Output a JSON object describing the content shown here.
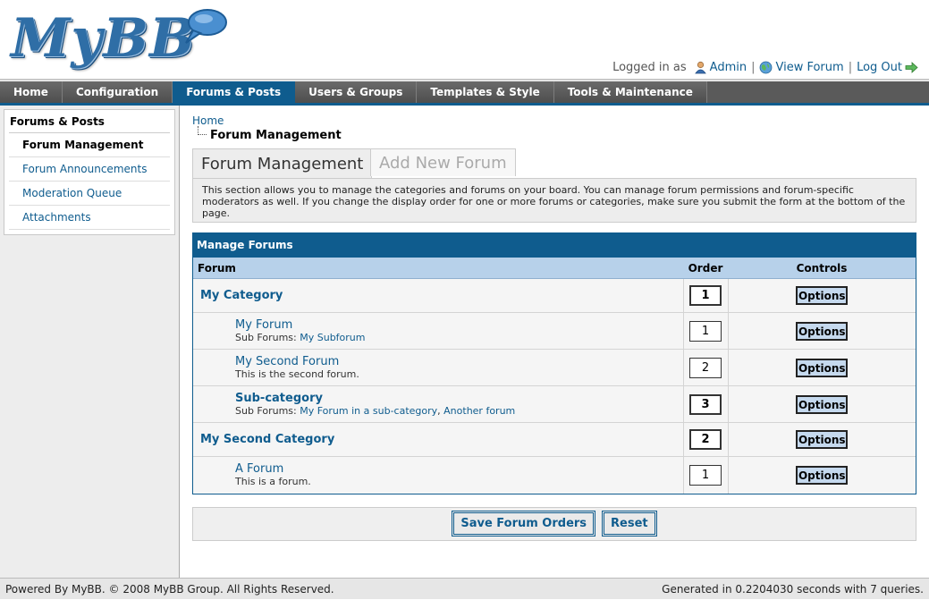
{
  "brand": {
    "logo_text": "MyBB"
  },
  "userbar": {
    "logged_in_as": "Logged in as",
    "user": "Admin",
    "view_forum": "View Forum",
    "logout": "Log Out"
  },
  "menu": [
    {
      "label": "Home"
    },
    {
      "label": "Configuration"
    },
    {
      "label": "Forums & Posts"
    },
    {
      "label": "Users & Groups"
    },
    {
      "label": "Templates & Style"
    },
    {
      "label": "Tools & Maintenance"
    }
  ],
  "sidebar": {
    "title": "Forums & Posts",
    "items": [
      {
        "label": "Forum Management"
      },
      {
        "label": "Forum Announcements"
      },
      {
        "label": "Moderation Queue"
      },
      {
        "label": "Attachments"
      }
    ]
  },
  "breadcrumb": {
    "home": "Home",
    "current": "Forum Management"
  },
  "tabs": {
    "active": "Forum Management",
    "inactive": "Add New Forum"
  },
  "description": "This section allows you to manage the categories and forums on your board. You can manage forum permissions and forum-specific moderators as well. If you change the display order for one or more forums or categories, make sure you submit the form at the bottom of the page.",
  "table": {
    "title": "Manage Forums",
    "headers": {
      "forum": "Forum",
      "order": "Order",
      "controls": "Controls"
    },
    "options_label": "Options",
    "rows": [
      {
        "name": "My Category",
        "order": "1"
      },
      {
        "name": "My Forum",
        "sub_label": "Sub Forums:",
        "sub_links": [
          "My Subforum"
        ],
        "order": "1"
      },
      {
        "name": "My Second Forum",
        "description": "This is the second forum.",
        "order": "2"
      },
      {
        "name": "Sub-category",
        "sub_label": "Sub Forums:",
        "sub_links": [
          "My Forum in a sub-category",
          "Another forum"
        ],
        "order": "3"
      },
      {
        "name": "My Second Category",
        "order": "2"
      },
      {
        "name": "A Forum",
        "description": "This is a forum.",
        "order": "1"
      }
    ]
  },
  "buttons": {
    "save": "Save Forum Orders",
    "reset": "Reset"
  },
  "footer": {
    "left": "Powered By MyBB. © 2008 MyBB Group. All Rights Reserved.",
    "right": "Generated in 0.2204030 seconds with 7 queries."
  }
}
